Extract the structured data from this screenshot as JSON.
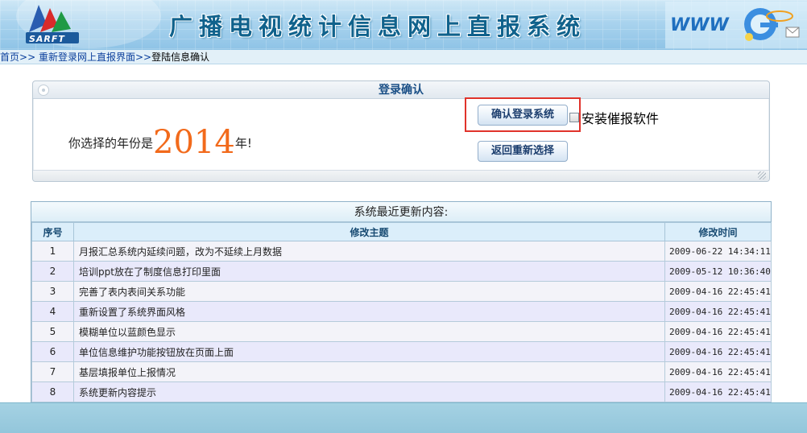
{
  "header": {
    "logo_caption": "SARFT",
    "system_title": "广播电视统计信息网上直报系统",
    "deco_text": "WWW"
  },
  "breadcrumb": {
    "home": "首页",
    "sep1": ">>",
    "relogin": "重新登录网上直报界面",
    "sep2": ">>",
    "current": "登陆信息确认"
  },
  "confirm_panel": {
    "title": "登录确认",
    "year_prefix": "你选择的年份是",
    "year": "2014",
    "year_suffix": "年!",
    "confirm_button": "确认登录系统",
    "install_checkbox_label": "安装催报软件",
    "install_checked": false,
    "return_button": "返回重新选择"
  },
  "updates": {
    "caption": "系统最近更新内容:",
    "columns": [
      "序号",
      "修改主题",
      "修改时间"
    ],
    "rows": [
      {
        "no": "1",
        "subject": "月报汇总系统内延续问题，改为不延续上月数据",
        "time": "2009-06-22 14:34:11"
      },
      {
        "no": "2",
        "subject": "培训ppt放在了制度信息打印里面",
        "time": "2009-05-12 10:36:40"
      },
      {
        "no": "3",
        "subject": "完善了表内表间关系功能",
        "time": "2009-04-16 22:45:41"
      },
      {
        "no": "4",
        "subject": "重新设置了系统界面风格",
        "time": "2009-04-16 22:45:41"
      },
      {
        "no": "5",
        "subject": "模糊单位以蓝颜色显示",
        "time": "2009-04-16 22:45:41"
      },
      {
        "no": "6",
        "subject": "单位信息维护功能按钮放在页面上面",
        "time": "2009-04-16 22:45:41"
      },
      {
        "no": "7",
        "subject": "基层填报单位上报情况",
        "time": "2009-04-16 22:45:41"
      },
      {
        "no": "8",
        "subject": "系统更新内容提示",
        "time": "2009-04-16 22:45:41"
      }
    ]
  },
  "colors": {
    "accent_orange": "#f26a1b",
    "highlight_red": "#e0332b",
    "link_blue": "#0b3f9c",
    "row_odd": "#f3f3f9",
    "row_even": "#e9e9fb"
  },
  "icons": [
    "sarft-logo-icon",
    "globe-web-icon",
    "panel-corner-icon",
    "resize-grip-icon",
    "checkbox-icon"
  ]
}
